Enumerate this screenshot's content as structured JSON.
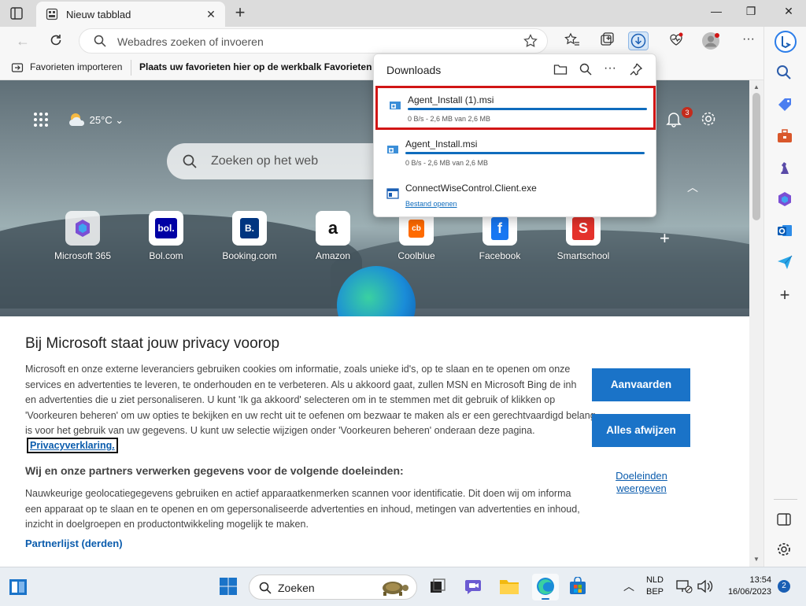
{
  "browser": {
    "tab_title": "Nieuw tabblad",
    "address_placeholder": "Webadres zoeken of invoeren",
    "favbar": {
      "import_label": "Favorieten importeren",
      "hint": "Plaats uw favorieten hier op de werkbalk Favorieten om"
    }
  },
  "newtab": {
    "temperature": "25°C",
    "search_placeholder": "Zoeken op het web",
    "notification_count": "3",
    "quicklinks": [
      {
        "label": "Microsoft 365",
        "icon": "m365-icon"
      },
      {
        "label": "Bol.com",
        "icon_text": "bol."
      },
      {
        "label": "Booking.com",
        "icon_text": "B."
      },
      {
        "label": "Amazon",
        "icon_text": "a"
      },
      {
        "label": "Coolblue",
        "icon_text": "cb"
      },
      {
        "label": "Facebook",
        "icon_text": "f"
      },
      {
        "label": "Smartschool",
        "icon_text": "S"
      }
    ]
  },
  "downloads": {
    "title": "Downloads",
    "items": [
      {
        "name": "Agent_Install (1).msi",
        "status": "0 B/s - 2,6 MB van 2,6 MB",
        "highlighted": true
      },
      {
        "name": "Agent_Install.msi",
        "status": "0 B/s - 2,6 MB van 2,6 MB"
      },
      {
        "name": "ConnectWiseControl.Client.exe",
        "action": "Bestand openen"
      }
    ]
  },
  "privacy": {
    "title": "Bij Microsoft staat jouw privacy voorop",
    "body_lines": [
      "Microsoft en onze externe leveranciers gebruiken cookies om informatie, zoals unieke id's, op te slaan en te openen om onze",
      "services en advertenties te leveren, te onderhouden en te verbeteren. Als u akkoord gaat, zullen MSN en Microsoft Bing de inh",
      "en advertenties die u ziet personaliseren. U kunt 'Ik ga akkoord' selecteren om in te stemmen met dit gebruik of klikken op",
      "'Voorkeuren beheren' om uw opties te bekijken en uw recht uit te oefenen om bezwaar te maken als er een gerechtvaardigd belang",
      "is voor het gebruik van uw gegevens.  U kunt uw selectie wijzigen onder 'Voorkeuren beheren' onderaan deze pagina."
    ],
    "privacy_link": "Privacyverklaring.",
    "subtitle": "Wij en onze partners verwerken gegevens voor de volgende doeleinden:",
    "body2_lines": [
      "Nauwkeurige geolocatiegegevens gebruiken en actief apparaatkenmerken scannen voor identificatie. Dit doen wij om informa",
      "een apparaat op te slaan en te openen en om gepersonaliseerde advertenties en inhoud, metingen van advertenties en inhoud,",
      "inzicht in doelgroepen en productontwikkeling mogelijk te maken."
    ],
    "partners_link": "Partnerlijst (derden)",
    "accept_label": "Aanvaarden",
    "reject_label": "Alles afwijzen",
    "purposes_link": "Doeleinden weergeven"
  },
  "taskbar": {
    "search_label": "Zoeken",
    "language": "NLD",
    "layout": "BEP",
    "time": "13:54",
    "date": "16/06/2023",
    "notifications": "2"
  },
  "colors": {
    "accent": "#1a73c8",
    "download_bar": "#0f6cbd",
    "highlight_border": "#d11515"
  }
}
